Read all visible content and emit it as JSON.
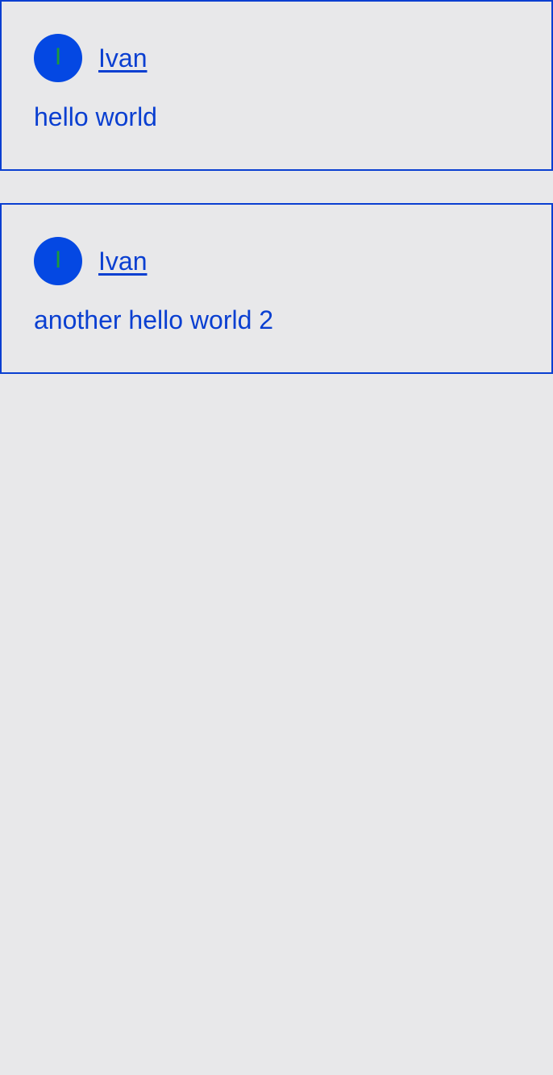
{
  "theme": {
    "background": "#e8e8ea",
    "accent": "#0a3fd1",
    "avatar_background": "#0448e3",
    "avatar_initial_color": "#1d9a3a"
  },
  "posts": [
    {
      "author": {
        "initial": "I",
        "name": "Ivan"
      },
      "text": "hello world"
    },
    {
      "author": {
        "initial": "I",
        "name": "Ivan"
      },
      "text": "another hello world 2"
    }
  ]
}
